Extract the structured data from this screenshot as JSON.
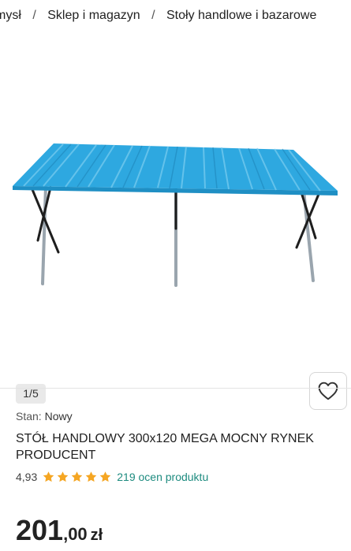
{
  "breadcrumb": {
    "items": [
      {
        "label": "mysł"
      },
      {
        "label": "Sklep i magazyn"
      },
      {
        "label": "Stoły handlowe i bazarowe"
      }
    ],
    "separator": "/"
  },
  "gallery": {
    "counter": "1/5",
    "wishlist_icon": "heart-outline-icon"
  },
  "product": {
    "condition_label": "Stan:",
    "condition_value": "Nowy",
    "title": "STÓŁ HANDLOWY 300x120 MEGA MOCNY RYNEK PRODUCENT",
    "rating_score": "4,93",
    "rating_stars": 5,
    "reviews_text": "219 ocen produktu",
    "price_int": "201",
    "price_dec": ",00",
    "price_currency": "zł"
  },
  "colors": {
    "star": "#f5a623",
    "review_link": "#1d8b7f",
    "table_top": "#2ea8e0"
  }
}
